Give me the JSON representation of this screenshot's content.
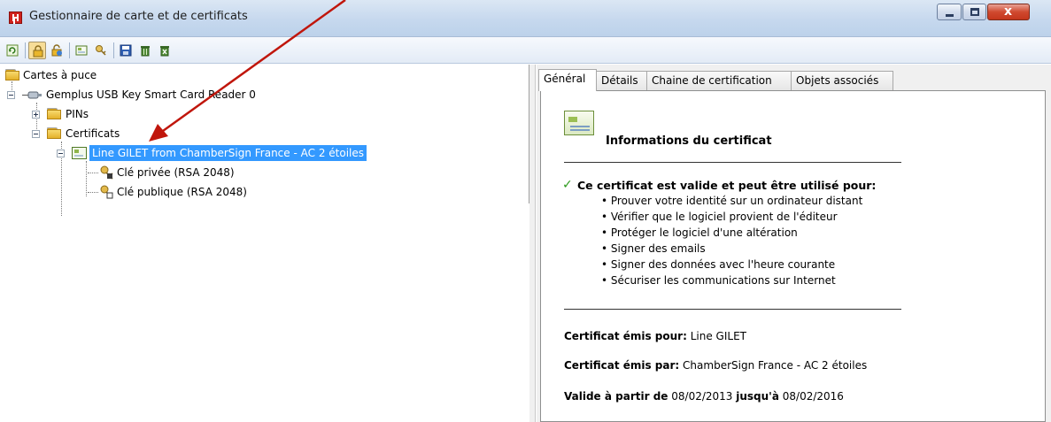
{
  "window": {
    "title": "Gestionnaire de carte et de certificats",
    "close_glyph": "x"
  },
  "toolbar": {
    "icons": [
      "refresh-icon",
      "lock-icon",
      "unlock-icon",
      "certificate-view-icon",
      "key-icon",
      "save-icon",
      "delete-icon",
      "delete-all-icon"
    ]
  },
  "tree": {
    "root_label": "Cartes à puce",
    "reader_label": "Gemplus USB Key Smart Card Reader 0",
    "pins_label": "PINs",
    "certs_label": "Certificats",
    "cert_label": "Line GILET from ChamberSign France - AC 2 étoiles",
    "private_key_label": "Clé privée (RSA 2048)",
    "public_key_label": "Clé publique (RSA 2048)"
  },
  "tabs": {
    "general": "Général",
    "details": "Détails",
    "chain": "Chaine de certification",
    "objects": "Objets associés"
  },
  "cert_info": {
    "heading": "Informations du certificat",
    "valid_intro": "Ce certificat est valide et peut être utilisé pour:",
    "uses": [
      "• Prouver votre identité sur un ordinateur distant",
      "• Vérifier que le logiciel provient de l'éditeur",
      "• Protéger le logiciel d'une altération",
      "• Signer des emails",
      "• Signer des données avec l'heure courante",
      "• Sécuriser les communications sur Internet"
    ],
    "issued_to_label": "Certificat émis pour:",
    "issued_to_value": "Line GILET",
    "issued_by_label": "Certificat émis par:",
    "issued_by_value": "ChamberSign France - AC 2 étoiles",
    "valid_from_label": "Valide à partir de",
    "valid_from_value": "08/02/2013",
    "valid_to_label": "jusqu'à",
    "valid_to_value": "08/02/2016"
  },
  "colors": {
    "selection": "#3399ff",
    "arrow": "#c0160c",
    "check": "#2c9a1c"
  }
}
